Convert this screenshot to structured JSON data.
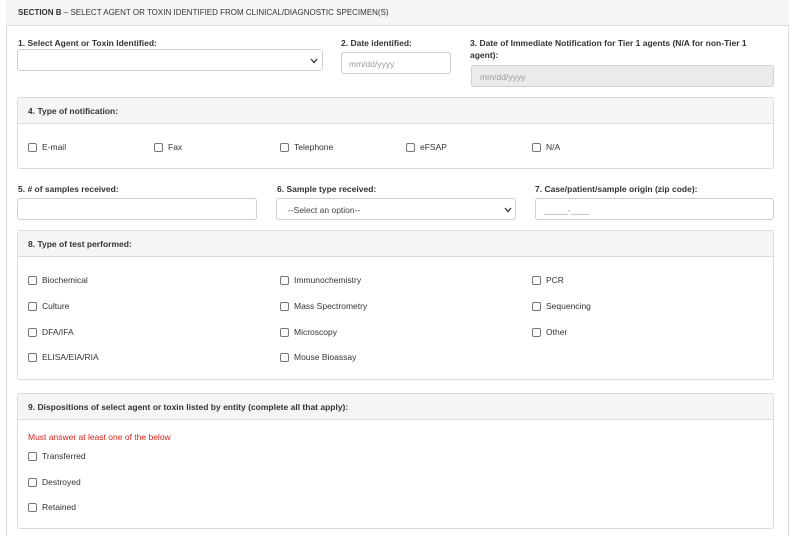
{
  "section": {
    "label": "SECTION B",
    "separator": " – ",
    "title": "SELECT AGENT OR TOXIN IDENTIFIED FROM CLINICAL/DIAGNOSTIC SPECIMEN(S)"
  },
  "q1": {
    "label": "1. Select Agent or Toxin Identified:",
    "value": ""
  },
  "q2": {
    "label": "2. Date identified:",
    "placeholder": "mm/dd/yyyy"
  },
  "q3": {
    "label_line1": "3. Date of Immediate Notification for Tier 1 agents (N/A for non-Tier 1",
    "label_line2": "agent):",
    "placeholder": "mm/dd/yyyy"
  },
  "q4": {
    "title": "4. Type of notification:",
    "options": [
      "E-mail",
      "Fax",
      "Telephone",
      "eFSAP",
      "N/A"
    ]
  },
  "q5": {
    "label": "5. # of samples received:"
  },
  "q6": {
    "label": "6. Sample type received:",
    "value": "--Select an option--"
  },
  "q7": {
    "label": "7. Case/patient/sample origin (zip code):",
    "placeholder": "_____-____"
  },
  "q8": {
    "title": "8. Type of test performed:",
    "options": [
      "Biochemical",
      "Culture",
      "DFA/IFA",
      "ELISA/EIA/RIA",
      "Immunochemistry",
      "Mass Spectrometry",
      "Microscopy",
      "Mouse Bioassay",
      "PCR",
      "Sequencing",
      "Other"
    ]
  },
  "q9": {
    "title": "9. Dispositions of select agent or toxin listed by entity (complete all that apply):",
    "warning": "Must answer at least one of the below",
    "options": [
      "Transferred",
      "Destroyed",
      "Retained"
    ]
  }
}
